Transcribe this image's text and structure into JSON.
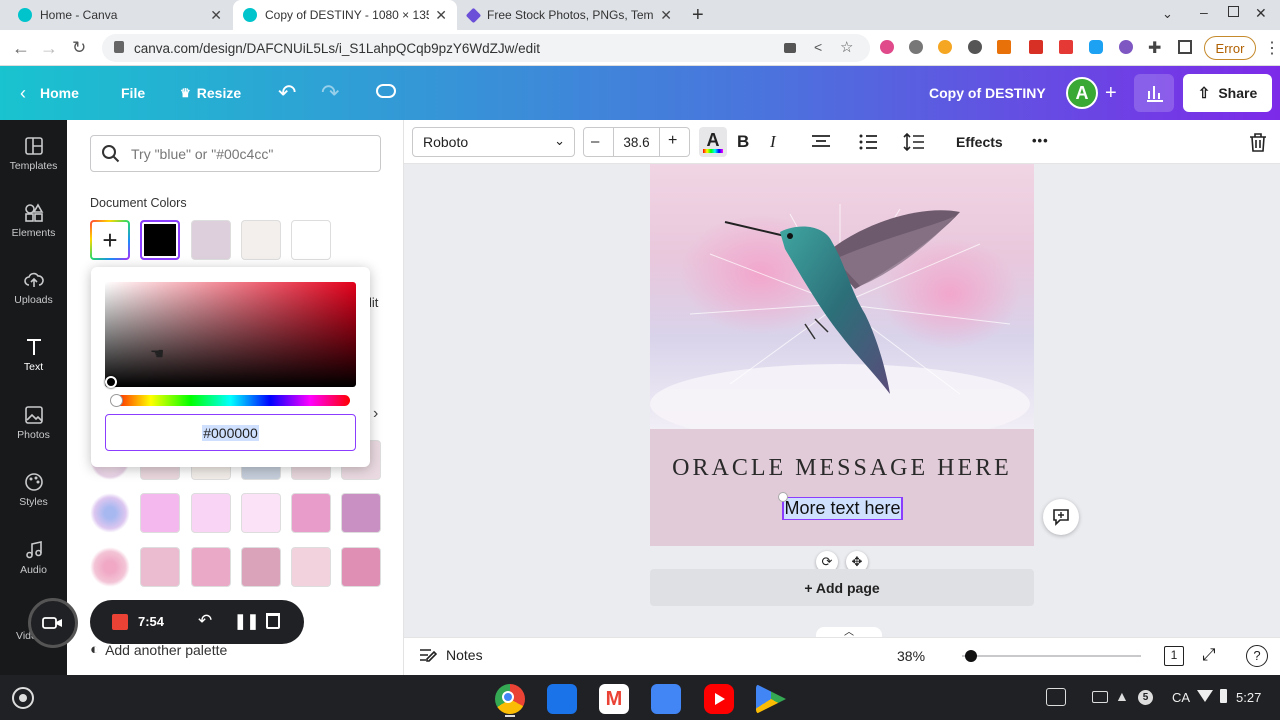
{
  "browser": {
    "tabs": [
      {
        "title": "Home - Canva"
      },
      {
        "title": "Copy of DESTINY - 1080 × 1350p"
      },
      {
        "title": "Free Stock Photos, PNGs, Templ"
      }
    ],
    "new_tab": "+",
    "url": "canva.com/design/DAFCNUiL5Ls/i_S1LahpQCqb9pzY6WdZJw/edit",
    "error_label": "Error"
  },
  "header": {
    "home": "Home",
    "file": "File",
    "resize": "Resize",
    "doc_title": "Copy of DESTINY",
    "avatar": "A",
    "share": "Share"
  },
  "rail": [
    {
      "label": "Templates",
      "icon": "templates-icon"
    },
    {
      "label": "Elements",
      "icon": "elements-icon"
    },
    {
      "label": "Uploads",
      "icon": "uploads-icon"
    },
    {
      "label": "Text",
      "icon": "text-icon"
    },
    {
      "label": "Photos",
      "icon": "photos-icon"
    },
    {
      "label": "Styles",
      "icon": "styles-icon"
    },
    {
      "label": "Audio",
      "icon": "audio-icon"
    },
    {
      "label": "Vide",
      "icon": "video-icon"
    }
  ],
  "panel": {
    "search_placeholder": "Try \"blue\" or \"#00c4cc\"",
    "document_colors": "Document Colors",
    "doc_swatches": [
      "#000000",
      "#ddd0dc",
      "#f3efec",
      "#ffffff"
    ],
    "partial_text": "lit",
    "hex_value": "#000000",
    "palette_rows": [
      [
        "#e8d6dc",
        "#f2ede8",
        "#c5cedb",
        "#e7d6dc",
        "#ead9e0"
      ],
      [
        "#f5b8ee",
        "#f9d4f5",
        "#fbe2f7",
        "#e89cc9",
        "#c990c3"
      ],
      [
        "#ebbcd0",
        "#eaa9c6",
        "#dba3ba",
        "#f1d2dd",
        "#e08fb4"
      ]
    ],
    "add_palette": "Add another palette"
  },
  "recorder": {
    "time": "7:54"
  },
  "toolbar": {
    "font": "Roboto",
    "minus": "–",
    "size": "38.6",
    "plus": "+",
    "bold": "B",
    "italic": "I",
    "effects": "Effects",
    "more": "•••"
  },
  "canvas": {
    "heading": "ORACLE MESSAGE HERE",
    "subtext": "More text here",
    "add_page": "+ Add page"
  },
  "status": {
    "notes": "Notes",
    "zoom": "38%",
    "page_count": "1",
    "zoom_fraction": 0.05
  },
  "shelf": {
    "lang": "CA",
    "notif_count": "5",
    "time": "5:27"
  }
}
